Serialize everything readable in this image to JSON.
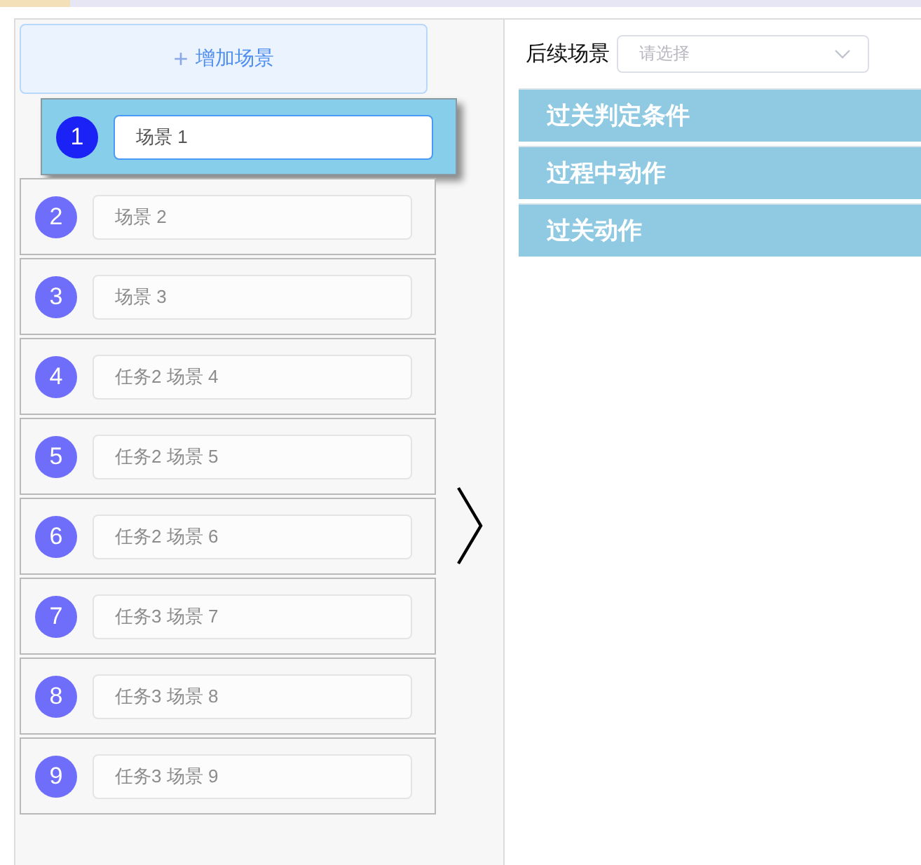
{
  "add_button": {
    "icon": "+",
    "label": "增加场景"
  },
  "scenes": [
    {
      "number": "1",
      "value": "场景 1",
      "selected": true
    },
    {
      "number": "2",
      "value": "场景 2",
      "selected": false
    },
    {
      "number": "3",
      "value": "场景 3",
      "selected": false
    },
    {
      "number": "4",
      "value": "任务2 场景 4",
      "selected": false
    },
    {
      "number": "5",
      "value": "任务2 场景 5",
      "selected": false
    },
    {
      "number": "6",
      "value": "任务2 场景 6",
      "selected": false
    },
    {
      "number": "7",
      "value": "任务3 场景 7",
      "selected": false
    },
    {
      "number": "8",
      "value": "任务3 场景 8",
      "selected": false
    },
    {
      "number": "9",
      "value": "任务3 场景 9",
      "selected": false
    }
  ],
  "next_scene": {
    "label": "后续场景",
    "placeholder": "请选择"
  },
  "sections": [
    {
      "title": "过关判定条件"
    },
    {
      "title": "过程中动作"
    },
    {
      "title": "过关动作"
    }
  ]
}
